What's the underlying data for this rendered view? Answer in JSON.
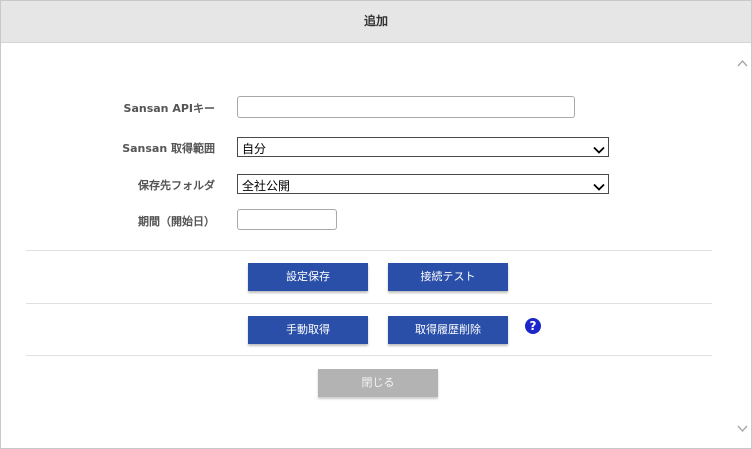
{
  "dialog": {
    "title": "追加"
  },
  "form": {
    "api_key_label": "Sansan APIキー",
    "api_key_value": "",
    "range_label": "Sansan 取得範囲",
    "range_value": "自分",
    "folder_label": "保存先フォルダ",
    "folder_value": "全社公開",
    "period_label": "期間（開始日）",
    "period_value": ""
  },
  "buttons": {
    "save": "設定保存",
    "test": "接続テスト",
    "manual": "手動取得",
    "delete_history": "取得履歴削除",
    "close": "閉じる"
  },
  "colors": {
    "primary": "#2a4fa8",
    "disabled": "#b3b3b3",
    "help": "#1d27c9"
  },
  "icons": {
    "help": "question-circle-icon",
    "scroll_up": "chevron-up-icon",
    "scroll_down": "chevron-down-icon"
  }
}
